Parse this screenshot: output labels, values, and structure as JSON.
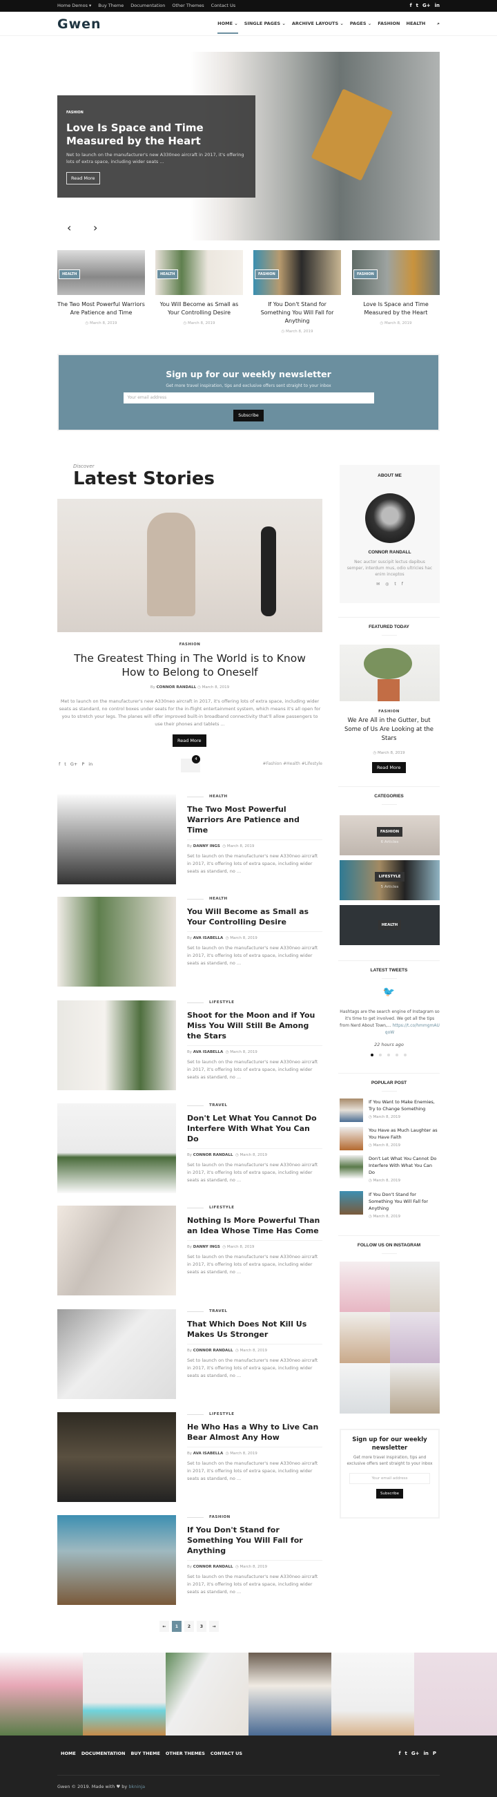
{
  "topbar": {
    "links": [
      "Home Demos ▾",
      "Buy Theme",
      "Documentation",
      "Other Themes",
      "Contact Us"
    ],
    "social": [
      "f",
      "t",
      "G+",
      "in"
    ]
  },
  "header": {
    "logo": "Gwen",
    "nav": [
      "HOME ⌄",
      "SINGLE PAGES ⌄",
      "ARCHIVE LAYOUTS ⌄",
      "PAGES ⌄",
      "FASHION",
      "HEALTH"
    ],
    "search_icon": "⌕"
  },
  "hero": {
    "category": "FASHION",
    "title": "Love Is Space and Time Measured by the Heart",
    "excerpt": "Net to launch on the manufacturer's new A330neo aircraft in 2017, it's offering lots of extra space, including wider seats ...",
    "read_more": "Read More",
    "prev": "‹",
    "next": "›"
  },
  "cards": [
    {
      "badge": "HEALTH",
      "title": "The Two Most Powerful Warriors Are Patience and Time",
      "date": "◷ March 8, 2019"
    },
    {
      "badge": "HEALTH",
      "title": "You Will Become as Small as Your Controlling Desire",
      "date": "◷ March 8, 2019"
    },
    {
      "badge": "FASHION",
      "title": "If You Don't Stand for Something You Will Fall for Anything",
      "date": "◷ March 8, 2019"
    },
    {
      "badge": "FASHION",
      "title": "Love Is Space and Time Measured by the Heart",
      "date": "◷ March 8, 2019"
    }
  ],
  "newsletter": {
    "title": "Sign up for our weekly newsletter",
    "text": "Get more travel inspiration, tips and exclusive offers sent straight to your inbox",
    "placeholder": "Your email address",
    "button": "Subscribe"
  },
  "latest": {
    "kicker": "Discover",
    "title": "Latest Stories"
  },
  "featured": {
    "category": "FASHION",
    "title": "The Greatest Thing in The World is to Know How to Belong to Oneself",
    "by": "By",
    "author": "CONNOR RANDALL",
    "date": "◷ March 8, 2019",
    "excerpt": "Met to launch on the manufacturer's new A330neo aircraft in 2017, it's offering lots of extra space, including wider seats as standard, no control boxes under seats for the in-flight entertainment system, which means it's all open for you to stretch your legs. The planes will offer improved built-in broadband connectivity that'll allow passengers to use their phones and tablets ...",
    "read_more": "Read More",
    "share": [
      "f",
      "t",
      "G+",
      "P",
      "in"
    ],
    "comments": "4",
    "tags": "#Fashion #Health #Lifestyle"
  },
  "posts": [
    {
      "category": "HEALTH",
      "title": "The Two Most Powerful Warriors Are Patience and Time",
      "author": "DANNY INGS",
      "date": "◷ March 8, 2019",
      "excerpt": "Set to launch on the manufacturer's new A330neo aircraft in 2017, it's offering lots of extra space, including wider seats as standard, no ..."
    },
    {
      "category": "HEALTH",
      "title": "You Will Become as Small as Your Controlling Desire",
      "author": "AVA ISABELLA",
      "date": "◷ March 8, 2019",
      "excerpt": "Set to launch on the manufacturer's new A330neo aircraft in 2017, it's offering lots of extra space, including wider seats as standard, no ..."
    },
    {
      "category": "LIFESTYLE",
      "title": "Shoot for the Moon and if You Miss You Will Still Be Among the Stars",
      "author": "AVA ISABELLA",
      "date": "◷ March 8, 2019",
      "excerpt": "Set to launch on the manufacturer's new A330neo aircraft in 2017, it's offering lots of extra space, including wider seats as standard, no ..."
    },
    {
      "category": "TRAVEL",
      "title": "Don't Let What You Cannot Do Interfere With What You Can Do",
      "author": "CONNOR RANDALL",
      "date": "◷ March 8, 2019",
      "excerpt": "Set to launch on the manufacturer's new A330neo aircraft in 2017, it's offering lots of extra space, including wider seats as standard, no ..."
    },
    {
      "category": "LIFESTYLE",
      "title": "Nothing Is More Powerful Than an Idea Whose Time Has Come",
      "author": "DANNY INGS",
      "date": "◷ March 8, 2019",
      "excerpt": "Set to launch on the manufacturer's new A330neo aircraft in 2017, it's offering lots of extra space, including wider seats as standard, no ..."
    },
    {
      "category": "TRAVEL",
      "title": "That Which Does Not Kill Us Makes Us Stronger",
      "author": "CONNOR RANDALL",
      "date": "◷ March 8, 2019",
      "excerpt": "Set to launch on the manufacturer's new A330neo aircraft in 2017, it's offering lots of extra space, including wider seats as standard, no ..."
    },
    {
      "category": "LIFESTYLE",
      "title": "He Who Has a Why to Live Can Bear Almost Any How",
      "author": "AVA ISABELLA",
      "date": "◷ March 8, 2019",
      "excerpt": "Set to launch on the manufacturer's new A330neo aircraft in 2017, it's offering lots of extra space, including wider seats as standard, no ..."
    },
    {
      "category": "FASHION",
      "title": "If You Don't Stand for Something You Will Fall for Anything",
      "author": "CONNOR RANDALL",
      "date": "◷ March 8, 2019",
      "excerpt": "Set to launch on the manufacturer's new A330neo aircraft in 2017, it's offering lots of extra space, including wider seats as standard, no ..."
    }
  ],
  "pagination": [
    "←",
    "1",
    "2",
    "3",
    "→"
  ],
  "sidebar": {
    "about": {
      "heading": "ABOUT ME",
      "name": "CONNOR RANDALL",
      "bio": "Nec auctor suscipit lectus dapibus semper, interdum mus, odio ultricies hac enim inceptos",
      "icons": [
        "✉",
        "◎",
        "t",
        "f"
      ]
    },
    "featured": {
      "heading": "FEATURED TODAY",
      "category": "FASHION",
      "title": "We Are All in the Gutter, but Some of Us Are Looking at the Stars",
      "date": "◷ March 8, 2019",
      "read_more": "Read More"
    },
    "categories": {
      "heading": "CATEGORIES",
      "items": [
        {
          "label": "FASHION",
          "count": "6 Articles"
        },
        {
          "label": "LIFESTYLE",
          "count": "5 Articles"
        },
        {
          "label": "HEALTH",
          "count": ""
        }
      ]
    },
    "tweets": {
      "heading": "LATEST TWEETS",
      "text": "Hashtags are the search engine of Instagram so it's time to get involved. We got all the tips from Nerd About Town,...",
      "link": "https://t.co/hmmgmAUqoW",
      "time": "22 hours ago"
    },
    "popular": {
      "heading": "POPULAR POST",
      "items": [
        {
          "title": "If You Want to Make Enemies, Try to Change Something",
          "date": "◷ March 8, 2019"
        },
        {
          "title": "You Have as Much Laughter as You Have Faith",
          "date": "◷ March 8, 2019"
        },
        {
          "title": "Don't Let What You Cannot Do Interfere With What You Can Do",
          "date": "◷ March 8, 2019"
        },
        {
          "title": "If You Don't Stand for Something You Will Fall for Anything",
          "date": "◷ March 8, 2019"
        }
      ]
    },
    "instagram": {
      "heading": "FOLLOW US ON INSTAGRAM"
    },
    "newsletter": {
      "title": "Sign up for our weekly newsletter",
      "text": "Get more travel inspiration, tips and exclusive offers sent straight to your inbox",
      "placeholder": "Your email address",
      "button": "Subscribe"
    }
  },
  "footer": {
    "nav": [
      "HOME",
      "DOCUMENTATION",
      "BUY THEME",
      "OTHER THEMES",
      "CONTACT US"
    ],
    "social": [
      "f",
      "t",
      "G+",
      "in",
      "P"
    ],
    "copy": "Gwen © 2019. Made with ♥ by",
    "copy_link": "bkninja"
  },
  "colors": {
    "accent": "#6b8f9f",
    "dark": "#111111",
    "footer": "#222222"
  }
}
